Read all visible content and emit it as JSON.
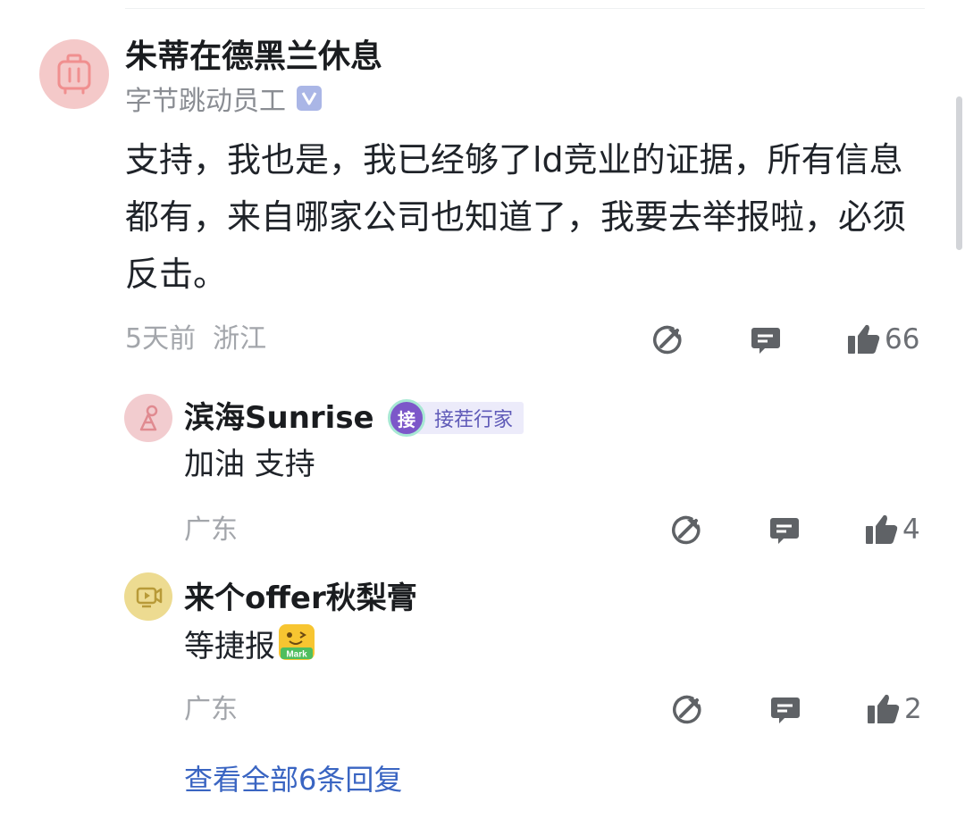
{
  "main_comment": {
    "author": "朱蒂在德黑兰休息",
    "author_title": "字节跳动员工",
    "text": "支持，我也是，我已经够了ld竞业的证据，所有信息都有，来自哪家公司也知道了，我要去举报啦，必须反击。",
    "time": "5天前",
    "location": "浙江",
    "likes": "66"
  },
  "replies": [
    {
      "author": "滨海Sunrise",
      "badge_icon_text": "接",
      "badge_label": "接茬行家",
      "text": "加油 支持",
      "location": "广东",
      "likes": "4"
    },
    {
      "author": "来个offer秋梨膏",
      "text": "等捷报",
      "emoji_label": "Mark",
      "location": "广东",
      "likes": "2"
    }
  ],
  "view_all_replies": "查看全部6条回复",
  "icons": {
    "share": "share-arrow-icon",
    "reply": "comment-bubble-icon",
    "like": "thumbs-up-icon",
    "verified": "verified-v-icon"
  },
  "colors": {
    "link_blue": "#3a65c2",
    "meta_gray": "#a3a6ab",
    "icon_gray": "#5f6266",
    "verified_blue": "#aab6e6",
    "badge_purple": "#7c57c9"
  }
}
